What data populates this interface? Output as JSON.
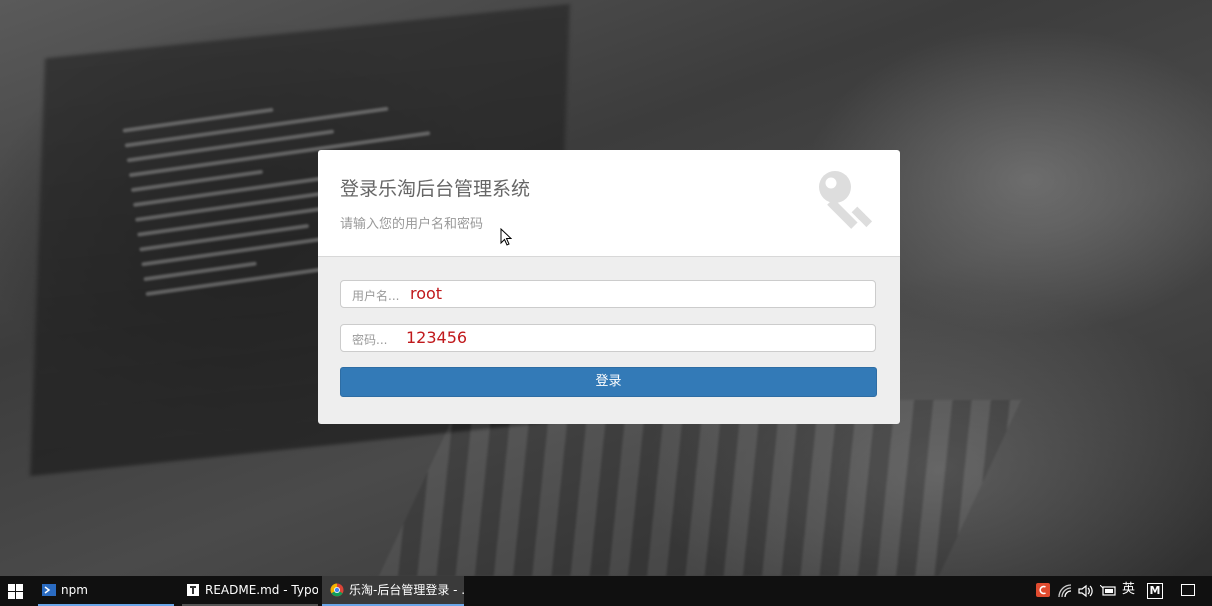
{
  "login": {
    "title": "登录乐淘后台管理系统",
    "subtitle": "请输入您的用户名和密码",
    "username_placeholder": "用户名...",
    "username_value": "root",
    "password_placeholder": "密码...",
    "password_value": "123456",
    "submit_label": "登录"
  },
  "taskbar": {
    "tasks": [
      {
        "label": "npm",
        "icon": "powershell-icon"
      },
      {
        "label": "README.md - Typo...",
        "icon": "typora-icon"
      },
      {
        "label": "乐淘-后台管理登录 - ...",
        "icon": "chrome-icon"
      }
    ],
    "tray": {
      "ime_label": "英",
      "m_label": "M"
    }
  },
  "colors": {
    "primary_button": "#337ab7",
    "typed_text": "#c0181b"
  }
}
